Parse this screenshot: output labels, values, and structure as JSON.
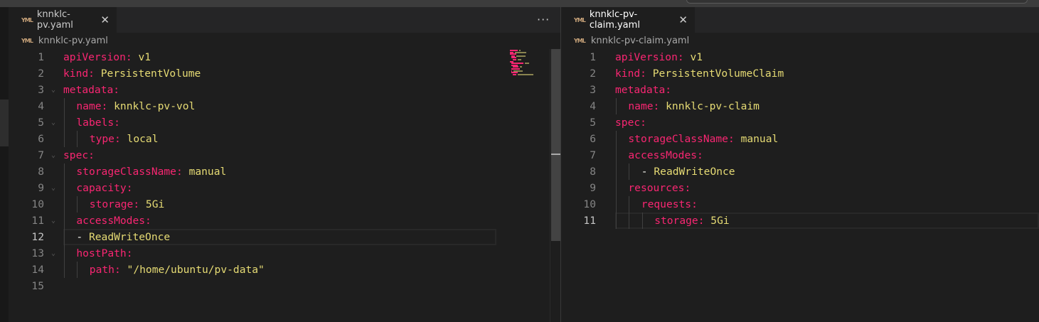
{
  "colors": {
    "key": "#f92672",
    "value": "#e6db74",
    "background": "#1e1e1e",
    "tabbar": "#252526"
  },
  "left": {
    "tab": {
      "icon": "yaml-file-icon",
      "label": "knnklc-pv.yaml",
      "close": "✕"
    },
    "more": "···",
    "breadcrumb": "knnklc-pv.yaml",
    "current_line": 12,
    "lines": [
      {
        "n": "1",
        "indent": 0,
        "key": "apiVersion",
        "value": "v1"
      },
      {
        "n": "2",
        "indent": 0,
        "key": "kind",
        "value": "PersistentVolume"
      },
      {
        "n": "3",
        "indent": 0,
        "key": "metadata",
        "value": "",
        "fold": true
      },
      {
        "n": "4",
        "indent": 1,
        "key": "name",
        "value": "knnklc-pv-vol"
      },
      {
        "n": "5",
        "indent": 1,
        "key": "labels",
        "value": "",
        "fold": true
      },
      {
        "n": "6",
        "indent": 2,
        "key": "type",
        "value": "local"
      },
      {
        "n": "7",
        "indent": 0,
        "key": "spec",
        "value": "",
        "fold": true
      },
      {
        "n": "8",
        "indent": 1,
        "key": "storageClassName",
        "value": "manual"
      },
      {
        "n": "9",
        "indent": 1,
        "key": "capacity",
        "value": "",
        "fold": true
      },
      {
        "n": "10",
        "indent": 2,
        "key": "storage",
        "value": "5Gi"
      },
      {
        "n": "11",
        "indent": 1,
        "key": "accessModes",
        "value": "",
        "fold": true
      },
      {
        "n": "12",
        "indent": 1,
        "item": "ReadWriteOnce"
      },
      {
        "n": "13",
        "indent": 1,
        "key": "hostPath",
        "value": "",
        "fold": true
      },
      {
        "n": "14",
        "indent": 2,
        "key": "path",
        "value": "\"/home/ubuntu/pv-data\""
      },
      {
        "n": "15",
        "indent": 0
      }
    ]
  },
  "right": {
    "tab": {
      "icon": "yaml-file-icon",
      "label": "knnklc-pv-claim.yaml",
      "close": "✕"
    },
    "breadcrumb": "knnklc-pv-claim.yaml",
    "current_line": 11,
    "lines": [
      {
        "n": "1",
        "indent": 0,
        "key": "apiVersion",
        "value": "v1"
      },
      {
        "n": "2",
        "indent": 0,
        "key": "kind",
        "value": "PersistentVolumeClaim"
      },
      {
        "n": "3",
        "indent": 0,
        "key": "metadata",
        "value": ""
      },
      {
        "n": "4",
        "indent": 1,
        "key": "name",
        "value": "knnklc-pv-claim"
      },
      {
        "n": "5",
        "indent": 0,
        "key": "spec",
        "value": ""
      },
      {
        "n": "6",
        "indent": 1,
        "key": "storageClassName",
        "value": "manual"
      },
      {
        "n": "7",
        "indent": 1,
        "key": "accessModes",
        "value": ""
      },
      {
        "n": "8",
        "indent": 2,
        "item": "ReadWriteOnce"
      },
      {
        "n": "9",
        "indent": 1,
        "key": "resources",
        "value": ""
      },
      {
        "n": "10",
        "indent": 2,
        "key": "requests",
        "value": ""
      },
      {
        "n": "11",
        "indent": 3,
        "key": "storage",
        "value": "5Gi"
      }
    ]
  }
}
